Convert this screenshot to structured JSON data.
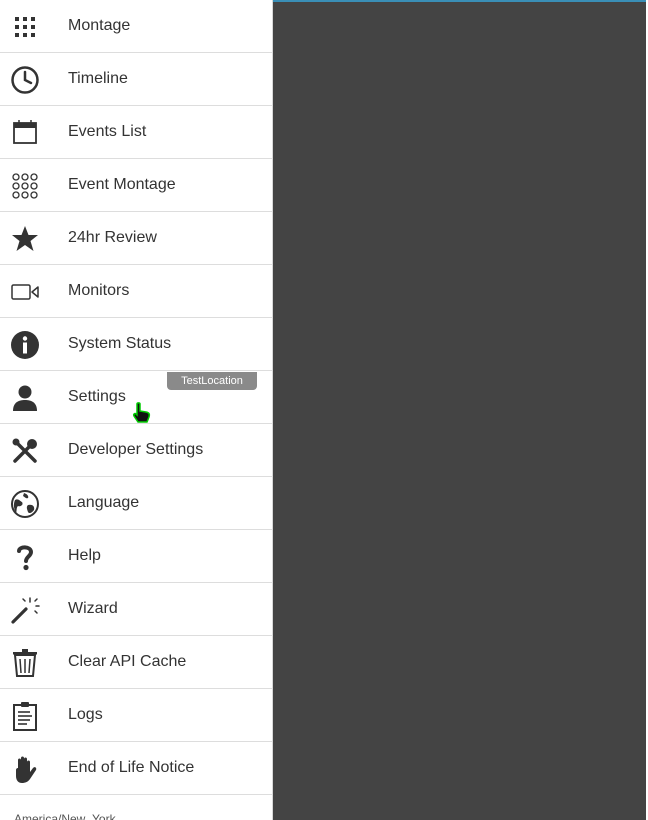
{
  "menu": {
    "items": [
      {
        "label": "Montage",
        "icon": "grid-icon"
      },
      {
        "label": "Timeline",
        "icon": "clock-icon"
      },
      {
        "label": "Events List",
        "icon": "calendar-icon"
      },
      {
        "label": "Event Montage",
        "icon": "dot-grid-icon"
      },
      {
        "label": "24hr Review",
        "icon": "star-icon"
      },
      {
        "label": "Monitors",
        "icon": "video-camera-icon"
      },
      {
        "label": "System Status",
        "icon": "info-icon"
      },
      {
        "label": "Settings",
        "icon": "person-icon"
      },
      {
        "label": "Developer Settings",
        "icon": "tools-icon"
      },
      {
        "label": "Language",
        "icon": "globe-icon"
      },
      {
        "label": "Help",
        "icon": "question-icon"
      },
      {
        "label": "Wizard",
        "icon": "magic-wand-icon"
      },
      {
        "label": "Clear API Cache",
        "icon": "trash-icon"
      },
      {
        "label": "Logs",
        "icon": "clipboard-icon"
      },
      {
        "label": "End of Life Notice",
        "icon": "hand-icon"
      }
    ],
    "badge": "TestLocation",
    "footer": "America/New_York"
  },
  "colors": {
    "overlay": "#444444",
    "accent": "#3a8fb7",
    "badge": "#8a8a8a"
  }
}
